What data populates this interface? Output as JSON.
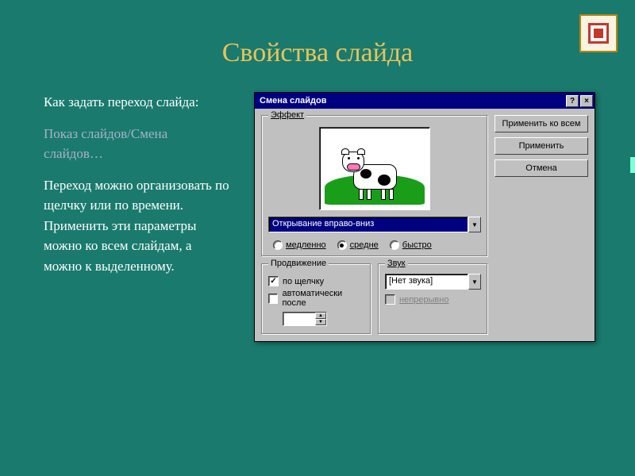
{
  "slide": {
    "title": "Свойства слайда",
    "text1": "Как задать переход слайда:",
    "text2": "Показ слайдов/Смена слайдов…",
    "text3": "Переход можно организовать по щелчку или по времени. Применить эти параметры можно ко всем слайдам, а можно к выделенному."
  },
  "dialog": {
    "title": "Смена слайдов",
    "help_glyph": "?",
    "close_glyph": "×",
    "effect_group": "Эффект",
    "effect_selected": "Открывание вправо-вниз",
    "speed_slow": "медленно",
    "speed_medium": "средне",
    "speed_fast": "быстро",
    "advance_group": "Продвижение",
    "advance_onclick": "по щелчку",
    "advance_auto": "автоматически после",
    "sound_group": "Звук",
    "sound_selected": "[Нет звука]",
    "sound_loop": "непрерывно",
    "btn_apply_all": "Применить ко всем",
    "btn_apply": "Применить",
    "btn_cancel": "Отмена"
  },
  "icons": {
    "dropdown_arrow": "▼",
    "spin_up": "▲",
    "spin_down": "▼"
  }
}
